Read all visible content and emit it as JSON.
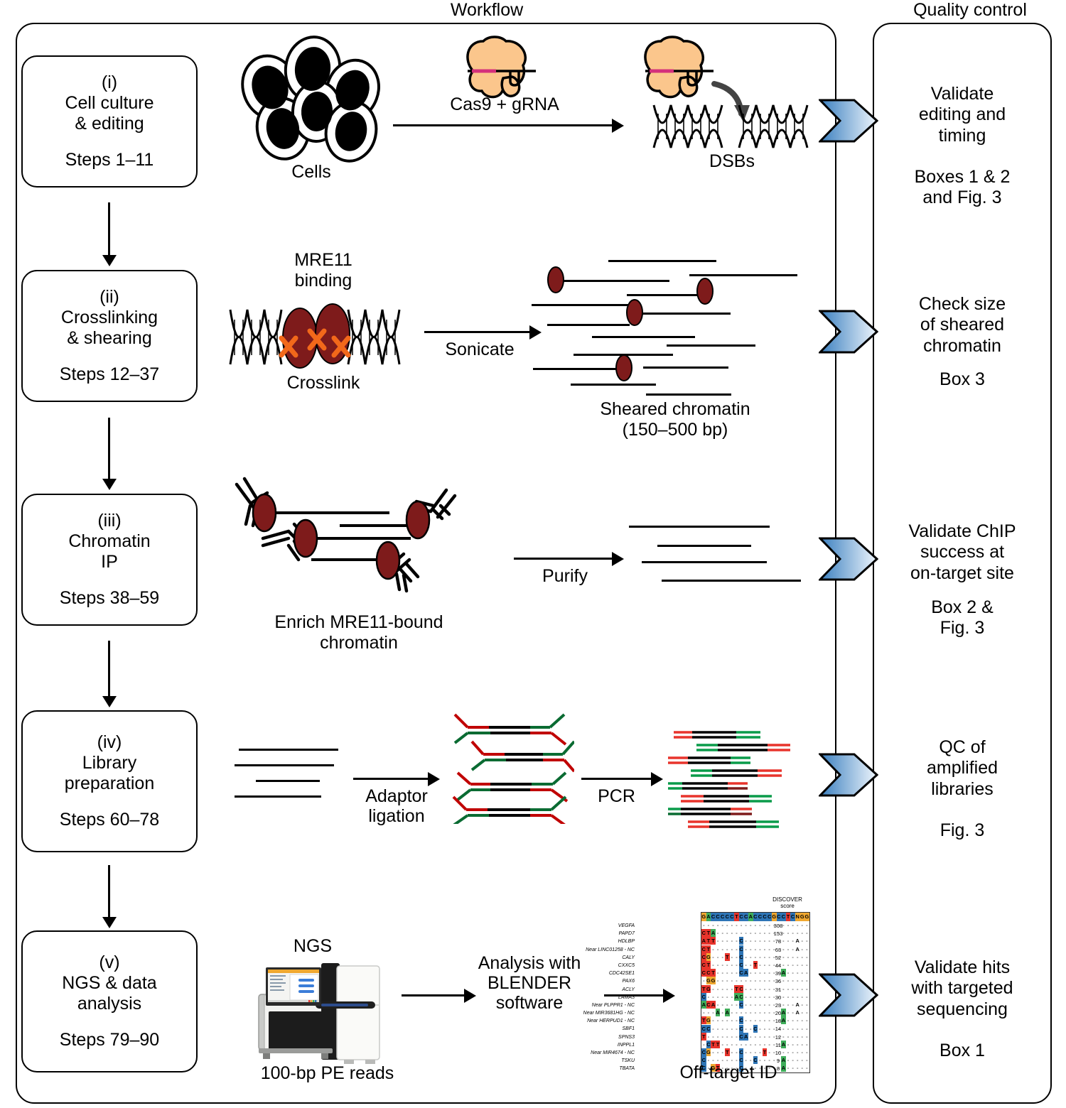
{
  "columns": {
    "workflow_header": "Workflow",
    "qc_header": "Quality control"
  },
  "stages": [
    {
      "roman": "(i)",
      "title": "Cell culture\n& editing",
      "steps": "Steps 1–11"
    },
    {
      "roman": "(ii)",
      "title": "Crosslinking\n& shearing",
      "steps": "Steps 12–37"
    },
    {
      "roman": "(iii)",
      "title": "Chromatin\nIP",
      "steps": "Steps 38–59"
    },
    {
      "roman": "(iv)",
      "title": "Library\npreparation",
      "steps": "Steps 60–78"
    },
    {
      "roman": "(v)",
      "title": "NGS & data\nanalysis",
      "steps": "Steps 79–90"
    }
  ],
  "quality_control": [
    {
      "text": "Validate\nediting and\ntiming",
      "ref": "Boxes 1 & 2\nand Fig. 3"
    },
    {
      "text": "Check size\nof sheared\nchromatin",
      "ref": "Box 3"
    },
    {
      "text": "Validate ChIP\nsuccess at\non-target site",
      "ref": "Box 2 &\nFig. 3"
    },
    {
      "text": "QC of\namplified\nlibraries",
      "ref": "Fig. 3"
    },
    {
      "text": "Validate hits\nwith targeted\nsequencing",
      "ref": "Box 1"
    }
  ],
  "workflow_labels": {
    "cells": "Cells",
    "cas9_grna": "Cas9 + gRNA",
    "dsbs": "DSBs",
    "mre11_binding": "MRE11\nbinding",
    "crosslink": "Crosslink",
    "sonicate": "Sonicate",
    "sheared_chromatin": "Sheared chromatin\n(150–500 bp)",
    "enrich": "Enrich MRE11-bound\nchromatin",
    "purify": "Purify",
    "adaptor_ligation": "Adaptor\nligation",
    "pcr": "PCR",
    "ngs": "NGS",
    "pe_reads": "100-bp PE reads",
    "blender": "Analysis with\nBLENDER\nsoftware",
    "off_target_id": "Off-target ID"
  },
  "colors": {
    "cas9_protein": "#FBC68C",
    "grna_pink": "#D4307B",
    "mre11_red": "#7E1B1B",
    "crosslink_orange": "#F2681A",
    "adaptor_red": "#C00000",
    "adaptor_green": "#0A6B32",
    "chevron_blue_dark": "#3A7FBF",
    "chevron_blue_light": "#EAF2FA",
    "outline": "#000000"
  },
  "chart_data": {
    "type": "heatmap",
    "title": "Off-target ID",
    "score_header": "DISCOVER\nscore",
    "reference_sequence": "GACCCCCTCCACCCCGCCTCNGG",
    "rows": [
      {
        "label": "VEGFA",
        "score": 308,
        "mismatches": []
      },
      {
        "label": "PAPD7",
        "score": 153,
        "mismatches": [
          [
            0,
            "C",
            "#E8342C"
          ],
          [
            1,
            "T",
            "#E8342C"
          ],
          [
            2,
            "A",
            "#3FAE5A"
          ]
        ]
      },
      {
        "label": "HDLBP",
        "score": 78,
        "mismatches": [
          [
            0,
            "A",
            "#E8342C"
          ],
          [
            1,
            "T",
            "#E8342C"
          ],
          [
            2,
            "T",
            "#E8342C"
          ],
          [
            8,
            "C",
            "#2E75B6"
          ],
          [
            20,
            "A",
            "#FFFFFF"
          ]
        ]
      },
      {
        "label": "Near LINC01258 - NC",
        "score": 63,
        "mismatches": [
          [
            0,
            "C",
            "#E8342C"
          ],
          [
            1,
            "T",
            "#E8342C"
          ],
          [
            8,
            "C",
            "#2E75B6"
          ],
          [
            20,
            "A",
            "#FFFFFF"
          ]
        ]
      },
      {
        "label": "CALY",
        "score": 52,
        "mismatches": [
          [
            0,
            "C",
            "#E8342C"
          ],
          [
            1,
            "G",
            "#F0A830"
          ],
          [
            5,
            "T",
            "#E8342C"
          ],
          [
            8,
            "C",
            "#2E75B6"
          ]
        ]
      },
      {
        "label": "CXXC5",
        "score": 44,
        "mismatches": [
          [
            0,
            "C",
            "#E8342C"
          ],
          [
            1,
            "T",
            "#E8342C"
          ],
          [
            8,
            "C",
            "#2E75B6"
          ],
          [
            11,
            "T",
            "#E8342C"
          ]
        ]
      },
      {
        "label": "CDC42SE1",
        "score": 39,
        "mismatches": [
          [
            0,
            "C",
            "#E8342C"
          ],
          [
            1,
            "C",
            "#E8342C"
          ],
          [
            2,
            "T",
            "#E8342C"
          ],
          [
            8,
            "C",
            "#2E75B6"
          ],
          [
            9,
            "A",
            "#2E75B6"
          ],
          [
            17,
            "A",
            "#3FAE5A"
          ]
        ]
      },
      {
        "label": "PAX6",
        "score": 36,
        "mismatches": [
          [
            1,
            "G",
            "#F0A830"
          ],
          [
            2,
            "G",
            "#F0A830"
          ]
        ]
      },
      {
        "label": "ACLY",
        "score": 31,
        "mismatches": [
          [
            0,
            "T",
            "#E8342C"
          ],
          [
            1,
            "G",
            "#E8342C"
          ],
          [
            7,
            "T",
            "#E8342C"
          ],
          [
            8,
            "C",
            "#E8342C"
          ]
        ]
      },
      {
        "label": "LAMA3",
        "score": 30,
        "mismatches": [
          [
            0,
            "C",
            "#2E75B6"
          ],
          [
            7,
            "A",
            "#3FAE5A"
          ],
          [
            8,
            "C",
            "#3FAE5A"
          ]
        ]
      },
      {
        "label": "Near PLPPR1 - NC",
        "score": 23,
        "mismatches": [
          [
            0,
            "A",
            "#3FAE5A"
          ],
          [
            1,
            "C",
            "#E8342C"
          ],
          [
            2,
            "A",
            "#E8342C"
          ],
          [
            8,
            "C",
            "#2E75B6"
          ],
          [
            20,
            "A",
            "#FFFFFF"
          ]
        ]
      },
      {
        "label": "Near MIR3681HG - NC",
        "score": 20,
        "mismatches": [
          [
            3,
            "A",
            "#3FAE5A"
          ],
          [
            5,
            "A",
            "#3FAE5A"
          ],
          [
            17,
            "A",
            "#3FAE5A"
          ],
          [
            20,
            "A",
            "#FFFFFF"
          ]
        ]
      },
      {
        "label": "Near HERPUD1 - NC",
        "score": 18,
        "mismatches": [
          [
            0,
            "T",
            "#E8342C"
          ],
          [
            1,
            "G",
            "#F0A830"
          ],
          [
            8,
            "C",
            "#2E75B6"
          ],
          [
            17,
            "A",
            "#3FAE5A"
          ]
        ]
      },
      {
        "label": "SBF1",
        "score": 14,
        "mismatches": [
          [
            0,
            "C",
            "#2E75B6"
          ],
          [
            1,
            "C",
            "#2E75B6"
          ],
          [
            8,
            "C",
            "#2E75B6"
          ],
          [
            11,
            "C",
            "#2E75B6"
          ]
        ]
      },
      {
        "label": "SPNS3",
        "score": 12,
        "mismatches": [
          [
            0,
            "T",
            "#E8342C"
          ],
          [
            8,
            "C",
            "#2E75B6"
          ],
          [
            9,
            "A",
            "#2E75B6"
          ]
        ]
      },
      {
        "label": "INPPL1",
        "score": 11,
        "mismatches": [
          [
            1,
            "C",
            "#2E75B6"
          ],
          [
            2,
            "T",
            "#E8342C"
          ],
          [
            3,
            "T",
            "#E8342C"
          ],
          [
            17,
            "A",
            "#3FAE5A"
          ]
        ]
      },
      {
        "label": "Near MIR4674 - NC",
        "score": 10,
        "mismatches": [
          [
            0,
            "C",
            "#2E75B6"
          ],
          [
            1,
            "G",
            "#F0A830"
          ],
          [
            5,
            "T",
            "#E8342C"
          ],
          [
            8,
            "C",
            "#2E75B6"
          ],
          [
            13,
            "T",
            "#E8342C"
          ]
        ]
      },
      {
        "label": "TSKU",
        "score": 9,
        "mismatches": [
          [
            0,
            "C",
            "#2E75B6"
          ],
          [
            8,
            "C",
            "#2E75B6"
          ],
          [
            11,
            "C",
            "#2E75B6"
          ],
          [
            17,
            "A",
            "#3FAE5A"
          ]
        ]
      },
      {
        "label": "TBATA",
        "score": 8,
        "mismatches": [
          [
            0,
            "C",
            "#2E75B6"
          ],
          [
            2,
            "G",
            "#F0A830"
          ],
          [
            3,
            "T",
            "#E8342C"
          ],
          [
            8,
            "C",
            "#2E75B6"
          ],
          [
            17,
            "A",
            "#3FAE5A"
          ]
        ]
      }
    ]
  }
}
